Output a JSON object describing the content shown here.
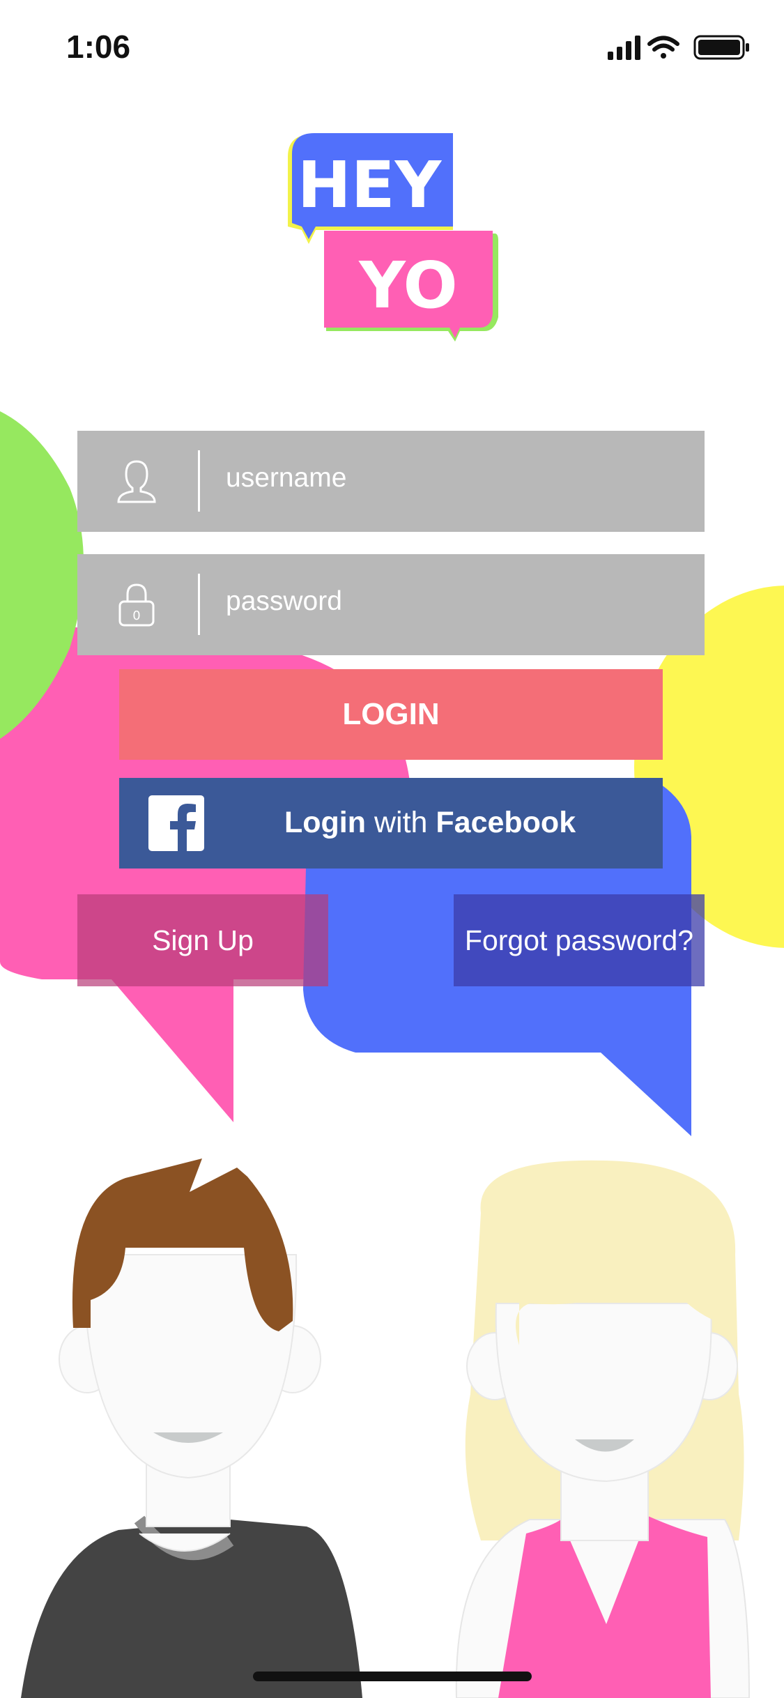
{
  "status_bar": {
    "time": "1:06"
  },
  "logo": {
    "line1": "HEY",
    "line2": "YO"
  },
  "form": {
    "username_placeholder": "username",
    "password_placeholder": "password"
  },
  "buttons": {
    "login": "LOGIN",
    "facebook_prefix": "Login",
    "facebook_mid": " with ",
    "facebook_brand": "Facebook",
    "signup": "Sign Up",
    "forgot": "Forgot password?"
  },
  "colors": {
    "logo_blue": "#5170fb",
    "logo_pink": "#ff5fb4",
    "bubble_green": "#96e85f",
    "bubble_yellow": "#fdf752",
    "login_red": "#f46e77",
    "facebook_blue": "#3b5998"
  },
  "icons": {
    "username": "user-icon",
    "password": "lock-icon",
    "facebook": "facebook-logo-icon"
  }
}
